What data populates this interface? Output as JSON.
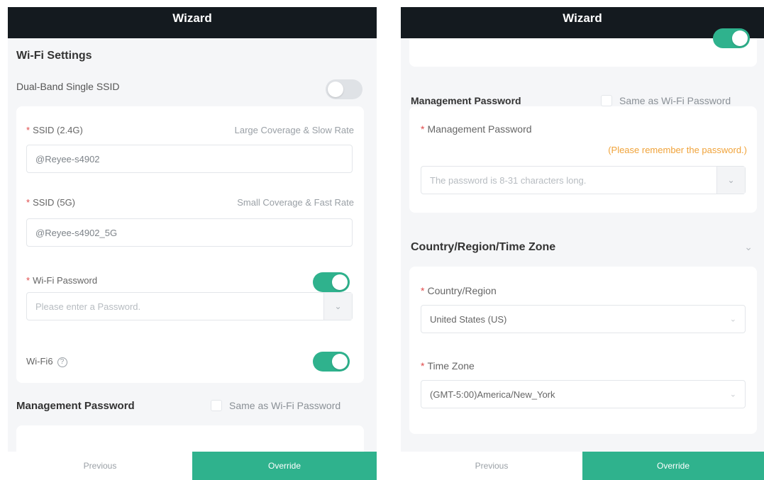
{
  "colors": {
    "accent": "#2fb28d",
    "topbar": "#141a1f",
    "warning": "#f0a33a"
  },
  "left": {
    "topbar_title": "Wizard",
    "wifi_settings_title": "Wi-Fi Settings",
    "dual_band_label": "Dual-Band Single SSID",
    "dual_band_on": false,
    "ssid24_label": "SSID (2.4G)",
    "ssid24_hint": "Large Coverage & Slow Rate",
    "ssid24_value": "@Reyee-s4902",
    "ssid5_label": "SSID (5G)",
    "ssid5_hint": "Small Coverage & Fast Rate",
    "ssid5_value": "@Reyee-s4902_5G",
    "wifi_password_label": "Wi-Fi Password",
    "wifi_password_on": true,
    "wifi_password_placeholder": "Please enter a Password.",
    "wifi6_label": "Wi-Fi6",
    "wifi6_on": true,
    "mgmt_password_title": "Management Password",
    "same_as_wifi_label": "Same as Wi-Fi Password",
    "prev_label": "Previous",
    "override_label": "Override"
  },
  "right": {
    "topbar_title": "Wizard",
    "mgmt_password_title": "Management Password",
    "same_as_wifi_label": "Same as Wi-Fi Password",
    "mgmt_password_label": "Management Password",
    "remember_hint": "(Please remember the password.)",
    "mgmt_password_placeholder": "The password is 8-31 characters long.",
    "country_section_title": "Country/Region/Time Zone",
    "country_label": "Country/Region",
    "country_value": "United States (US)",
    "timezone_label": "Time Zone",
    "timezone_value": "(GMT-5:00)America/New_York",
    "prev_label": "Previous",
    "override_label": "Override"
  },
  "icons": {
    "eye": "eye-icon",
    "help": "help-circle-icon",
    "chevron": "chevron-down-icon"
  }
}
